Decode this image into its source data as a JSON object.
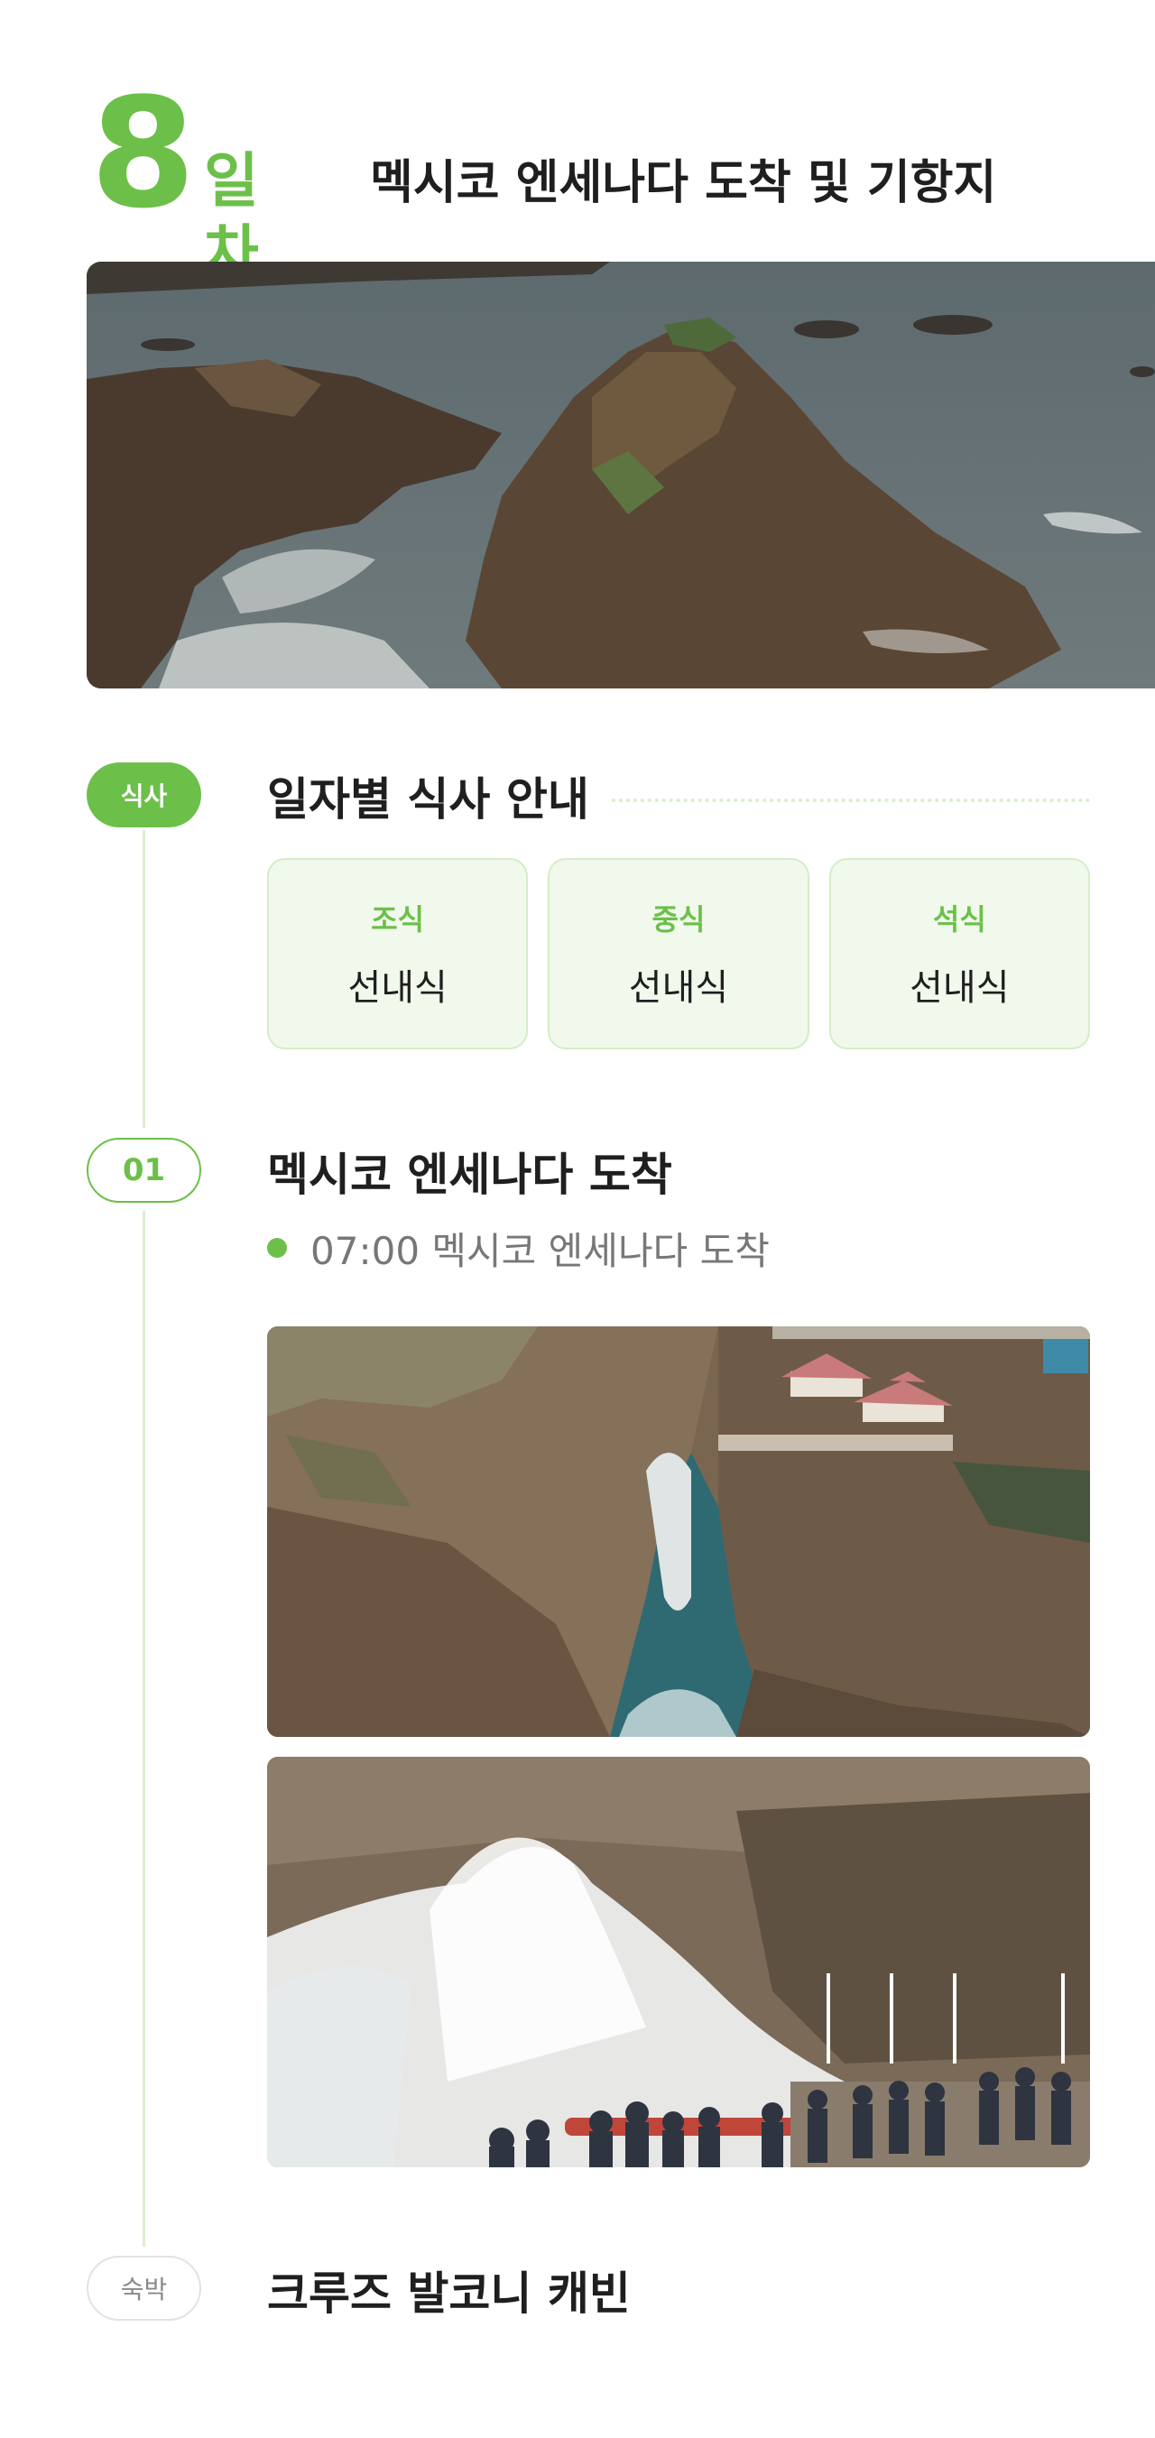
{
  "header": {
    "day_number": "8",
    "day_unit": "일차",
    "title": "멕시코 엔세나다 도착 및 기항지"
  },
  "meal_section": {
    "pill": "식사",
    "title": "일자별 식사 안내",
    "meals": [
      {
        "label": "조식",
        "value": "선내식"
      },
      {
        "label": "중식",
        "value": "선내식"
      },
      {
        "label": "석식",
        "value": "선내식"
      }
    ]
  },
  "stop_section": {
    "pill": "01",
    "title": "멕시코 엔세나다 도착",
    "schedule": [
      {
        "text": "07:00 멕시코 엔세나다 도착"
      }
    ]
  },
  "lodging_section": {
    "pill": "숙박",
    "title": "크루즈 발코니 캐빈"
  },
  "colors": {
    "accent": "#6cc04a",
    "accent_light": "#f1f9ec",
    "line": "#d9efcf"
  }
}
